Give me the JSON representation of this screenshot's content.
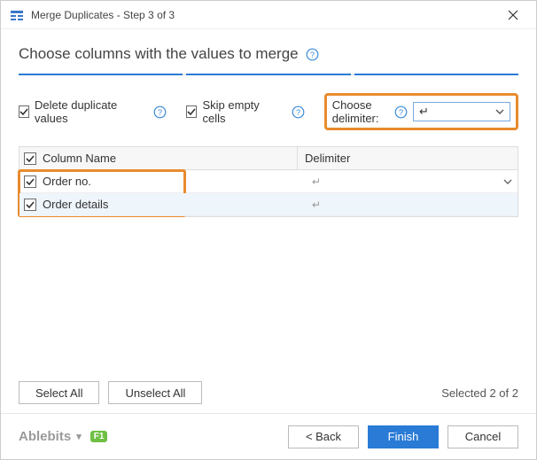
{
  "window": {
    "title": "Merge Duplicates - Step 3 of 3"
  },
  "heading": "Choose columns with the values to merge",
  "options": {
    "delete_dup_label": "Delete duplicate values",
    "skip_empty_label": "Skip empty cells",
    "choose_delimiter_label": "Choose delimiter:",
    "delimiter_value": "↵"
  },
  "table": {
    "header_col_name": "Column Name",
    "header_delimiter": "Delimiter",
    "rows": [
      {
        "name": "Order no.",
        "delimiter": "↵"
      },
      {
        "name": "Order details",
        "delimiter": "↵"
      }
    ]
  },
  "buttons": {
    "select_all": "Select All",
    "unselect_all": "Unselect All",
    "selected_count": "Selected 2 of 2",
    "back": "< Back",
    "finish": "Finish",
    "cancel": "Cancel"
  },
  "brand": {
    "name": "Ablebits",
    "f1": "F1"
  }
}
